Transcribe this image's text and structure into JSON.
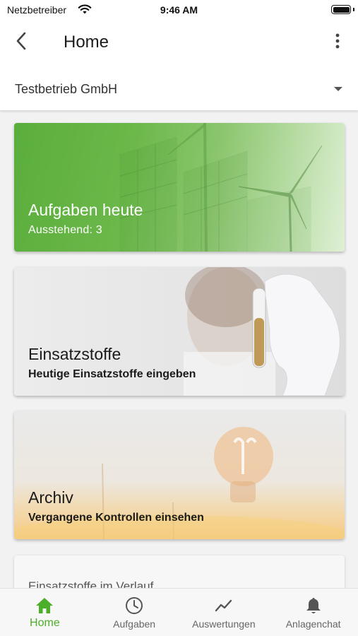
{
  "status_bar": {
    "carrier": "Netzbetreiber",
    "time": "9:46 AM",
    "battery_level": 1.0
  },
  "header": {
    "title": "Home",
    "back_icon": "chevron-left-icon",
    "menu_icon": "more-vertical-icon"
  },
  "company_selector": {
    "value": "Testbetrieb GmbH",
    "icon": "caret-down-icon"
  },
  "cards": {
    "tasks": {
      "title": "Aufgaben heute",
      "subtitle": "Ausstehend: 3",
      "image": "wind-turbines-solar-panels"
    },
    "stoffe": {
      "title": "Einsatzstoffe",
      "subtitle": "Heutige Einsatzstoffe eingeben",
      "image": "scientist-test-tube"
    },
    "archiv": {
      "title": "Archiv",
      "subtitle": "Vergangene Kontrollen einsehen",
      "image": "lightbulb-sunset"
    },
    "chart": {
      "title": "Einsatzstoffe im Verlauf",
      "more": "..."
    }
  },
  "bottom_nav": {
    "items": [
      {
        "label": "Home",
        "icon": "home-icon",
        "active": true
      },
      {
        "label": "Aufgaben",
        "icon": "clock-icon",
        "active": false
      },
      {
        "label": "Auswertungen",
        "icon": "trend-chart-icon",
        "active": false
      },
      {
        "label": "Anlagenchat",
        "icon": "bell-icon",
        "active": false
      }
    ]
  },
  "colors": {
    "accent": "#4caf2a",
    "inactive": "#666666",
    "tasks_card": "#5aae3c"
  }
}
